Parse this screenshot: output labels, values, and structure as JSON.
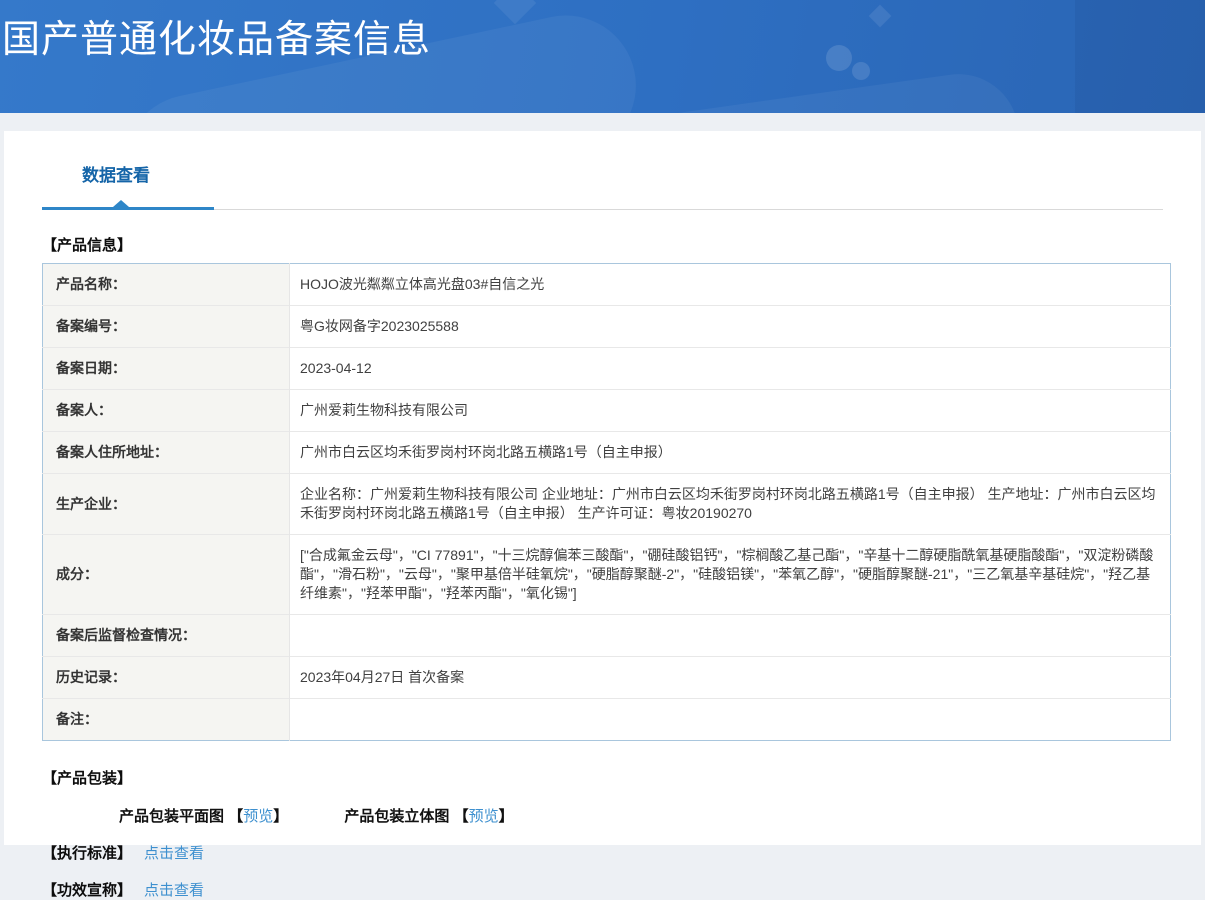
{
  "banner": {
    "title": "国产普通化妆品备案信息"
  },
  "tabs": {
    "data_view": "数据查看"
  },
  "sections": {
    "product_info_title": "【产品信息】",
    "product_packaging_title": "【产品包装】",
    "execution_standard_title": "【执行标准】",
    "efficacy_claim_title": "【功效宣称】"
  },
  "product_info": {
    "rows": [
      {
        "label": "产品名称：",
        "value": "HOJO波光粼粼立体高光盘03#自信之光"
      },
      {
        "label": "备案编号：",
        "value": "粤G妆网备字2023025588"
      },
      {
        "label": "备案日期：",
        "value": "2023-04-12"
      },
      {
        "label": "备案人：",
        "value": "广州爱莉生物科技有限公司"
      },
      {
        "label": "备案人住所地址：",
        "value": "广州市白云区均禾街罗岗村环岗北路五横路1号（自主申报）"
      },
      {
        "label": "生产企业：",
        "value": "企业名称：广州爱莉生物科技有限公司 企业地址：广州市白云区均禾街罗岗村环岗北路五横路1号（自主申报） 生产地址：广州市白云区均禾街罗岗村环岗北路五横路1号（自主申报） 生产许可证：粤妆20190270"
      },
      {
        "label": "成分：",
        "value": "[\"合成氟金云母\"，\"CI 77891\"，\"十三烷醇偏苯三酸酯\"，\"硼硅酸铝钙\"，\"棕榈酸乙基己酯\"，\"辛基十二醇硬脂酰氧基硬脂酸酯\"，\"双淀粉磷酸酯\"，\"滑石粉\"，\"云母\"，\"聚甲基倍半硅氧烷\"，\"硬脂醇聚醚-2\"，\"硅酸铝镁\"，\"苯氧乙醇\"，\"硬脂醇聚醚-21\"，\"三乙氧基辛基硅烷\"，\"羟乙基纤维素\"，\"羟苯甲酯\"，\"羟苯丙酯\"，\"氧化锡\"]"
      },
      {
        "label": "备案后监督检查情况：",
        "value": ""
      },
      {
        "label": "历史记录：",
        "value": "2023年04月27日 首次备案"
      },
      {
        "label": "备注：",
        "value": ""
      }
    ]
  },
  "packaging": {
    "flat_label": "产品包装平面图",
    "stereo_label": "产品包装立体图",
    "preview_link": "预览",
    "bracket_open": "【",
    "bracket_close": "】"
  },
  "links": {
    "click_to_view": "点击查看"
  },
  "colors": {
    "banner_gradient_start": "#3579ca",
    "banner_gradient_end": "#2a65b4",
    "tab_active": "#1565a8",
    "tab_underline": "#2e86c8",
    "table_outer_border": "#a9c6dd",
    "table_label_bg": "#f5f5f2",
    "link_blue": "#3e90cf",
    "page_bg": "#edf0f4"
  }
}
